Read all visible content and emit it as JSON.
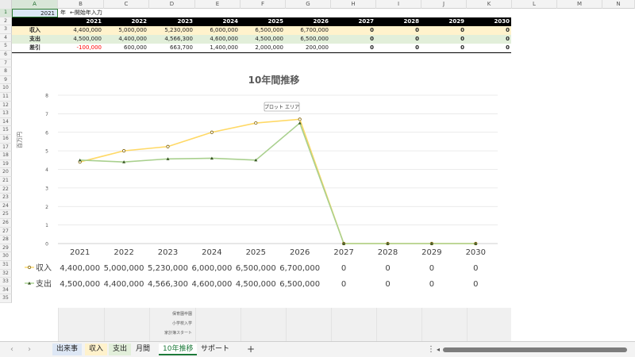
{
  "columns": [
    "A",
    "B",
    "C",
    "D",
    "E",
    "F",
    "G",
    "H",
    "I",
    "J",
    "K",
    "L",
    "M",
    "N"
  ],
  "rows": [
    "1",
    "2",
    "3",
    "4",
    "5",
    "6",
    "7",
    "8",
    "9",
    "10",
    "11",
    "12",
    "13",
    "14",
    "15",
    "16",
    "17",
    "18",
    "19",
    "20",
    "21",
    "22",
    "23",
    "24",
    "25",
    "26",
    "27",
    "28",
    "29",
    "30",
    "31",
    "32",
    "33",
    "34",
    "35"
  ],
  "row1": {
    "a1": "2021",
    "b1": "年",
    "c1": "←開始年入力"
  },
  "years": [
    "2021",
    "2022",
    "2023",
    "2024",
    "2025",
    "2026",
    "2027",
    "2028",
    "2029",
    "2030"
  ],
  "table": [
    {
      "label": "収入",
      "values": [
        "4,400,000",
        "5,000,000",
        "5,230,000",
        "6,000,000",
        "6,500,000",
        "6,700,000",
        "0",
        "0",
        "0",
        "0"
      ]
    },
    {
      "label": "支出",
      "values": [
        "4,500,000",
        "4,400,000",
        "4,566,300",
        "4,600,000",
        "4,500,000",
        "6,500,000",
        "0",
        "0",
        "0",
        "0"
      ]
    },
    {
      "label": "差引",
      "values": [
        "-100,000",
        "600,000",
        "663,700",
        "1,400,000",
        "2,000,000",
        "200,000",
        "0",
        "0",
        "0",
        "0"
      ]
    }
  ],
  "colors": {
    "income_band": "#fff2cc",
    "expense_band": "#e2efda",
    "income_line": "#ffd966",
    "expense_line": "#a9d08e",
    "negative": "#ff0000",
    "accent": "#1d7a3a"
  },
  "chart_data": {
    "type": "line",
    "title": "10年間推移",
    "ylabel": "百万円",
    "tooltip": "プロット エリア",
    "categories": [
      "2021",
      "2022",
      "2023",
      "2024",
      "2025",
      "2026",
      "2027",
      "2028",
      "2029",
      "2030"
    ],
    "y_ticks": [
      "0",
      "1",
      "2",
      "3",
      "4",
      "5",
      "6",
      "7",
      "8"
    ],
    "ylim": [
      0,
      8
    ],
    "grid": true,
    "legend": "bottom-table",
    "series": [
      {
        "name": "収入",
        "values": [
          4.4,
          5.0,
          5.23,
          6.0,
          6.5,
          6.7,
          0,
          0,
          0,
          0
        ],
        "labels": [
          "4,400,000",
          "5,000,000",
          "5,230,000",
          "6,000,000",
          "6,500,000",
          "6,700,000",
          "0",
          "0",
          "0",
          "0"
        ]
      },
      {
        "name": "支出",
        "values": [
          4.5,
          4.4,
          4.5663,
          4.6,
          4.5,
          6.5,
          0,
          0,
          0,
          0
        ],
        "labels": [
          "4,500,000",
          "4,400,000",
          "4,566,300",
          "4,600,000",
          "4,500,000",
          "6,500,000",
          "0",
          "0",
          "0",
          "0"
        ]
      }
    ]
  },
  "lower_labels": [
    "保育園卒園",
    "小学校入学",
    "家計簿スタート"
  ],
  "tabs": [
    {
      "label": "出来事",
      "color": "#dde7f5"
    },
    {
      "label": "収入",
      "color": "#fff2cc"
    },
    {
      "label": "支出",
      "color": "#e2efda"
    },
    {
      "label": "月間",
      "color": ""
    },
    {
      "label": "10年推移",
      "color": "",
      "active": true
    },
    {
      "label": "サポート",
      "color": ""
    }
  ],
  "tabbar": {
    "add_label": "+",
    "prev_label": "‹",
    "next_label": "›",
    "more_label": "⋮",
    "scroll_left_label": "◂"
  }
}
